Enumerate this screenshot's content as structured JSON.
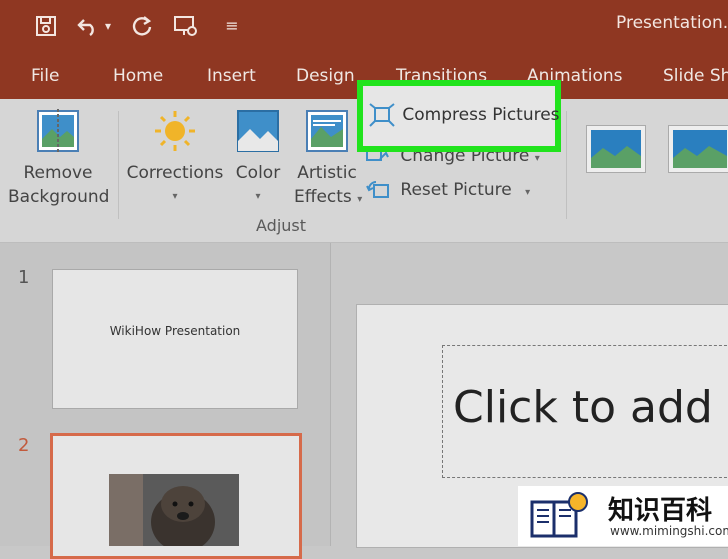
{
  "window": {
    "title": "Presentation.p"
  },
  "quick_access": [
    {
      "name": "save-icon",
      "glyph": "🖫"
    },
    {
      "name": "undo-icon",
      "glyph": "↶"
    },
    {
      "name": "undo-dropdown-icon",
      "glyph": "▾"
    },
    {
      "name": "redo-icon",
      "glyph": "↻"
    },
    {
      "name": "present-icon",
      "glyph": "⎚"
    },
    {
      "name": "customize-qat-icon",
      "glyph": "≡"
    }
  ],
  "tabs": [
    "File",
    "Home",
    "Insert",
    "Design",
    "Transitions",
    "Animations",
    "Slide Sh"
  ],
  "ribbon": {
    "remove_background": {
      "line1": "Remove",
      "line2": "Background"
    },
    "corrections": {
      "label": "Corrections",
      "caret": "▾"
    },
    "color": {
      "label": "Color",
      "caret": "▾"
    },
    "artistic_effects": {
      "line1": "Artistic",
      "line2": "Effects",
      "caret": "▾"
    },
    "compress_pictures": "Compress Pictures",
    "change_picture": "Change Picture",
    "change_caret": "▾",
    "reset_picture": "Reset Picture",
    "reset_caret": "▾",
    "group_label": "Adjust"
  },
  "slides": [
    {
      "number": "1",
      "text": "WikiHow Presentation"
    },
    {
      "number": "2",
      "text": ""
    }
  ],
  "canvas": {
    "placeholder": "Click to add"
  },
  "watermark": {
    "title": "知识百科",
    "url": "www.mimingshi.com"
  },
  "colors": {
    "accent": "#8f3722",
    "highlight": "#21e31d",
    "selected_slide": "#d66a4a"
  }
}
